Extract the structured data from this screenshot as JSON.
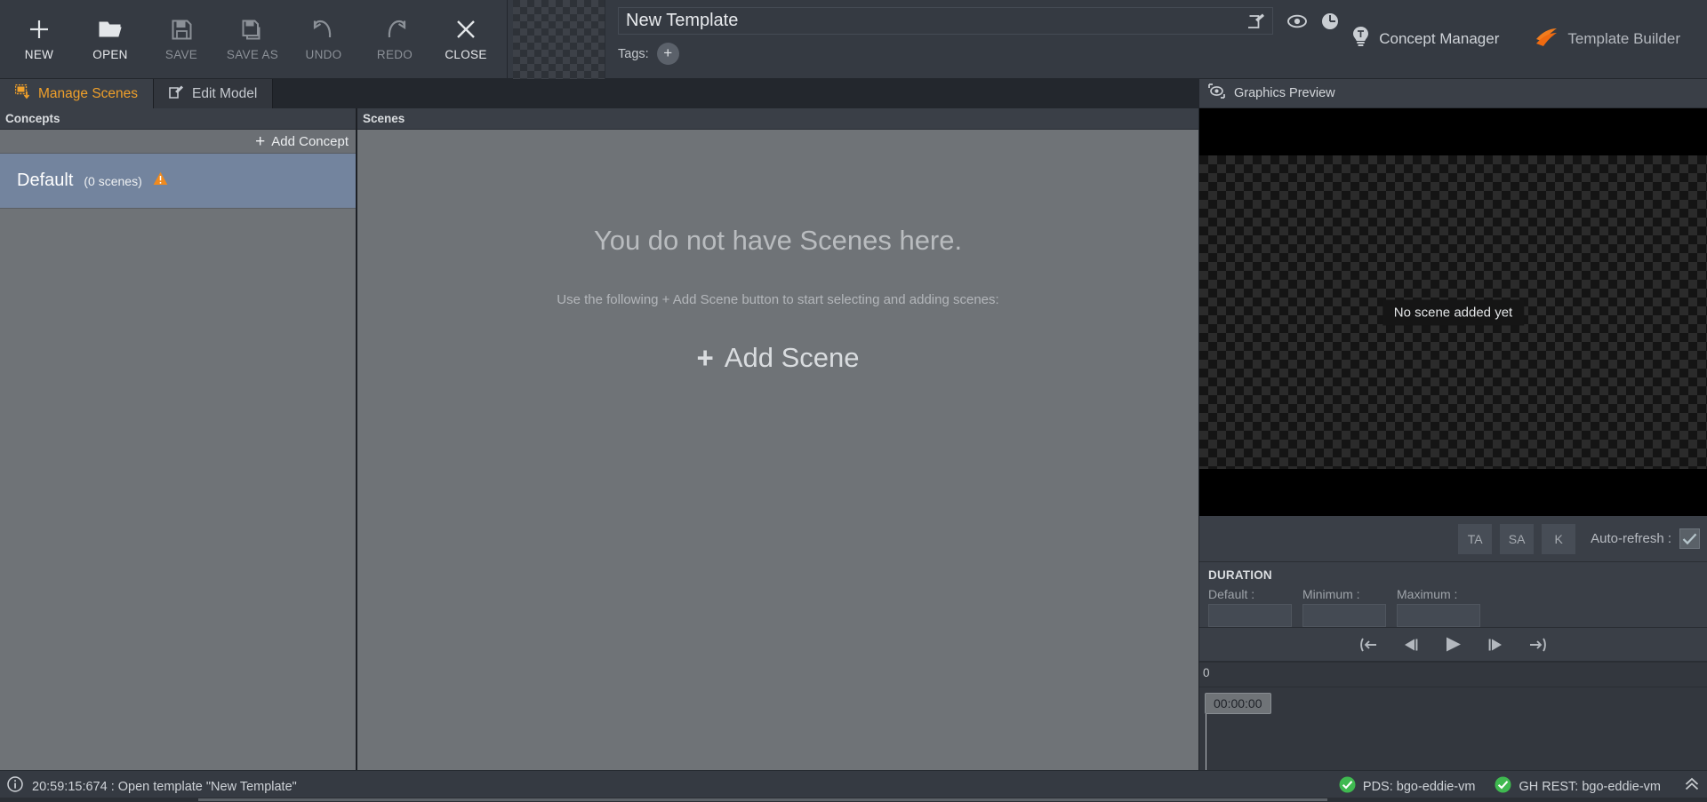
{
  "toolbar": {
    "buttons": [
      {
        "label": "NEW",
        "icon": "plus-icon",
        "enabled": true
      },
      {
        "label": "OPEN",
        "icon": "folder-open-icon",
        "enabled": true
      },
      {
        "label": "SAVE",
        "icon": "floppy-disk-icon",
        "enabled": false
      },
      {
        "label": "SAVE AS",
        "icon": "floppy-disk-copy-icon",
        "enabled": false
      },
      {
        "label": "UNDO",
        "icon": "undo-arrow-icon",
        "enabled": false
      },
      {
        "label": "REDO",
        "icon": "redo-arrow-icon",
        "enabled": false
      },
      {
        "label": "CLOSE",
        "icon": "close-x-icon",
        "enabled": true
      }
    ],
    "template_title": "New Template",
    "title_placeholder": "Template name",
    "title_edit_icon": "rename-pencil-icon",
    "title_icons": [
      {
        "name": "eye-icon"
      },
      {
        "name": "clock-history-icon"
      }
    ],
    "tags_label": "Tags:",
    "tag_add_glyph": "+",
    "concept_manager": {
      "label": "Concept Manager",
      "icon": "lightbulb-icon"
    },
    "template_builder": {
      "label": "Template Builder",
      "icon": "template-builder-logo-icon"
    }
  },
  "tabs": [
    {
      "label": "Manage Scenes",
      "icon": "manage-scenes-icon",
      "active": true
    },
    {
      "label": "Edit Model",
      "icon": "edit-model-icon",
      "active": false
    }
  ],
  "concepts": {
    "header": "Concepts",
    "add_label": "Add Concept",
    "add_glyph": "+",
    "items": [
      {
        "name": "Default",
        "count": "(0 scenes)",
        "warning_icon": "warning-triangle-icon",
        "selected": true
      }
    ]
  },
  "scenes": {
    "header": "Scenes",
    "empty_title": "You do not have Scenes here.",
    "empty_sub": "Use the following + Add Scene button to start selecting and adding scenes:",
    "add_scene_label": "Add Scene",
    "add_scene_glyph": "+"
  },
  "preview": {
    "header": "Graphics Preview",
    "header_icon": "preview-eye-icon",
    "tooltip": "No scene added yet",
    "buttons": [
      {
        "label": "TA"
      },
      {
        "label": "SA"
      },
      {
        "label": "K"
      }
    ],
    "auto_refresh_label": "Auto-refresh :",
    "auto_refresh_checked": true,
    "check_glyph": "✓"
  },
  "duration": {
    "title": "DURATION",
    "fields": [
      {
        "label": "Default :",
        "value": ""
      },
      {
        "label": "Minimum :",
        "value": ""
      },
      {
        "label": "Maximum :",
        "value": ""
      }
    ]
  },
  "transport": [
    {
      "name": "go-to-start-icon"
    },
    {
      "name": "step-back-icon"
    },
    {
      "name": "play-icon"
    },
    {
      "name": "step-forward-icon"
    },
    {
      "name": "go-to-end-icon"
    }
  ],
  "timeline": {
    "tick_label": "0",
    "playhead_time": "00:00:00"
  },
  "statusbar": {
    "info_icon": "info-circle-icon",
    "message": "20:59:15:674 : Open template \"New Template\"",
    "connections": [
      {
        "label": "PDS: bgo-eddie-vm",
        "status_icon": "check-circle-green-icon"
      },
      {
        "label": "GH REST: bgo-eddie-vm",
        "status_icon": "check-circle-green-icon"
      }
    ],
    "expand_glyph": "«"
  },
  "colors": {
    "accent_orange": "#f0a02a",
    "selection_blue": "#73849e",
    "status_green": "#3fb950",
    "panel_dark": "#3a3f47",
    "panel_gray": "#6f7377"
  }
}
